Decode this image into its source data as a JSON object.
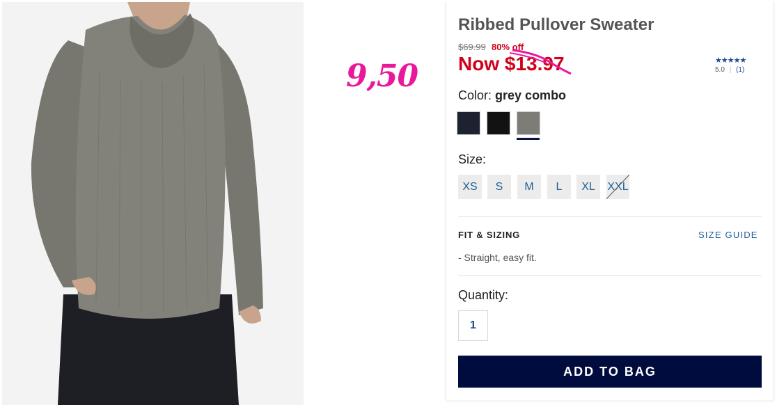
{
  "annotation": "9,50",
  "product": {
    "title": "Ribbed Pullover Sweater",
    "original_price": "$69.99",
    "discount": "80% off",
    "now_price": "Now $13.97",
    "rating": {
      "stars": "★★★★★",
      "score": "5.0",
      "sep": "|",
      "count": "(1)"
    }
  },
  "color": {
    "label": "Color:",
    "selected": "grey combo",
    "swatches": [
      {
        "name": "navy",
        "hex": "#1c2230"
      },
      {
        "name": "black",
        "hex": "#121212"
      },
      {
        "name": "grey combo",
        "hex": "#7d7c77"
      }
    ]
  },
  "size": {
    "label": "Size:",
    "options": [
      "XS",
      "S",
      "M",
      "L",
      "XL",
      "XXL"
    ],
    "unavailable": [
      "XXL"
    ]
  },
  "fit": {
    "title": "FIT & SIZING",
    "guide_link": "SIZE GUIDE",
    "description": "- Straight, easy fit."
  },
  "quantity": {
    "label": "Quantity:",
    "value": "1"
  },
  "cta": {
    "add_to_bag": "ADD TO BAG"
  },
  "colors": {
    "sale_red": "#d0021b",
    "link_blue": "#1f5f96",
    "cta_navy": "#000c3e",
    "annotation_pink": "#e8199a"
  }
}
